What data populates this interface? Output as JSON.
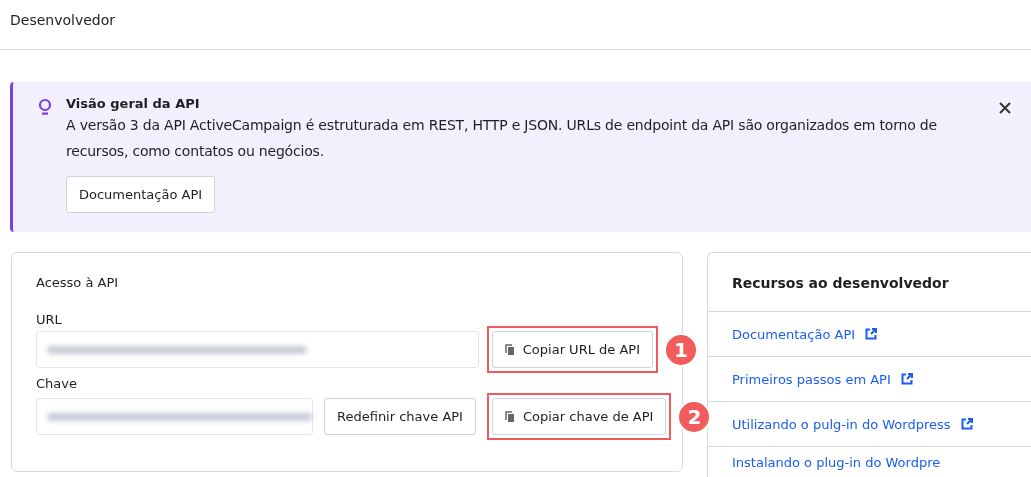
{
  "header": {
    "title": "Desenvolvedor"
  },
  "banner": {
    "title": "Visão geral da API",
    "text": "A versão 3 da API ActiveCampaign é estruturada em REST, HTTP e JSON. URLs de endpoint da API são organizados em torno de recursos, como contatos ou negócios.",
    "button": "Documentação API",
    "closable": true
  },
  "access": {
    "title": "Acesso à API",
    "fields": [
      {
        "label": "URL",
        "value_hidden": true,
        "buttons": [
          {
            "label": "Copiar URL de API",
            "kind": "copy",
            "highlighted": true,
            "marker": "1"
          }
        ]
      },
      {
        "label": "Chave",
        "value_hidden": true,
        "buttons": [
          {
            "label": "Redefinir chave API",
            "kind": "plain",
            "highlighted": false
          },
          {
            "label": "Copiar chave de API",
            "kind": "copy",
            "highlighted": true,
            "marker": "2"
          }
        ]
      }
    ]
  },
  "resources": {
    "title": "Recursos ao desenvolvedor",
    "links": [
      {
        "label": "Documentação API",
        "external": true
      },
      {
        "label": "Primeiros passos em API",
        "external": true
      },
      {
        "label": "Utilizando o pulg-in do Wordpress",
        "external": true
      },
      {
        "label": "Instalando o plug-in do Wordpre"
      }
    ]
  }
}
